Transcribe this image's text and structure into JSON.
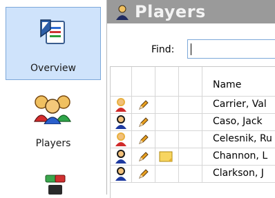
{
  "sidebar": {
    "items": [
      {
        "label": "Overview",
        "icon": "overview-document-icon",
        "active": true
      },
      {
        "label": "Players",
        "icon": "players-group-icon",
        "active": false
      },
      {
        "label": "",
        "icon": "teams-icon",
        "active": false
      }
    ]
  },
  "header": {
    "title": "Players",
    "icon": "player-icon"
  },
  "search": {
    "label": "Find:",
    "value": ""
  },
  "table": {
    "name_header": "Name",
    "rows": [
      {
        "name": "Carrier, Val",
        "avatar": "female-player-icon",
        "edit_icon": "pencil-icon",
        "note": false
      },
      {
        "name": "Caso, Jack",
        "avatar": "male-player-icon",
        "edit_icon": "pencil-icon",
        "note": false
      },
      {
        "name": "Celesnik, Ru",
        "avatar": "female-player-icon",
        "edit_icon": "pencil-icon",
        "note": false
      },
      {
        "name": "Channon, L",
        "avatar": "male-player-icon",
        "edit_icon": "pencil-icon",
        "note": true
      },
      {
        "name": "Clarkson, J",
        "avatar": "male-player-icon",
        "edit_icon": "pencil-icon",
        "note": false
      }
    ]
  },
  "colors": {
    "accent": "#7ba7d9",
    "header_bg": "#9a9a9a",
    "active_bg": "#cfe3fb"
  }
}
